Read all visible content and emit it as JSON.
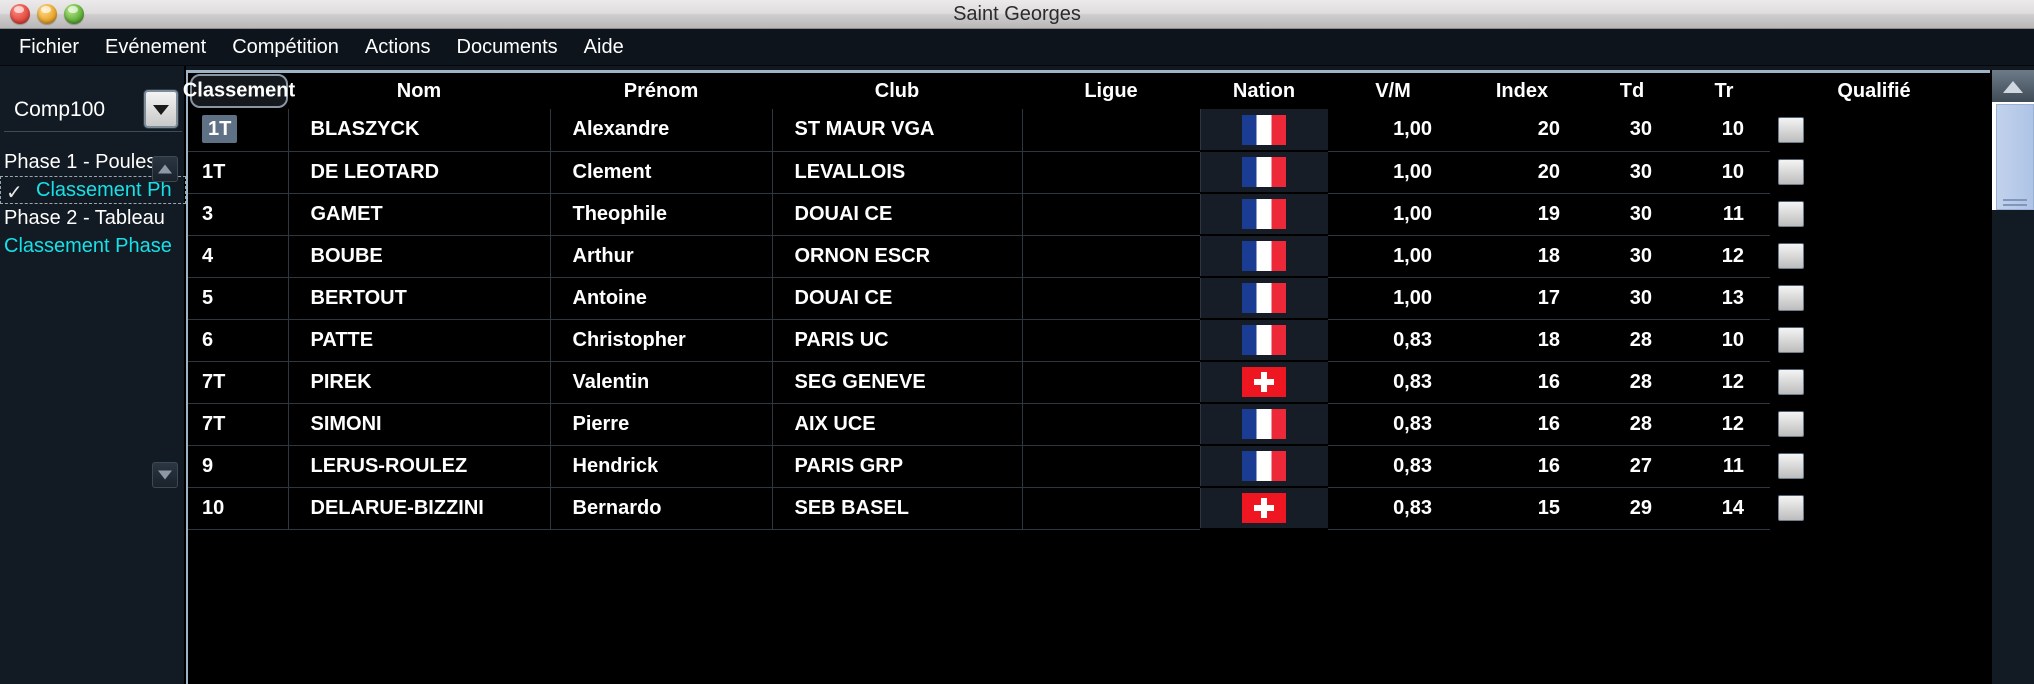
{
  "window": {
    "title": "Saint Georges",
    "buttons": {
      "close": "close-button",
      "minimize": "minimize-button",
      "maximize": "maximize-button"
    }
  },
  "menubar": {
    "items": [
      "Fichier",
      "Evénement",
      "Compétition",
      "Actions",
      "Documents",
      "Aide"
    ]
  },
  "sidebar": {
    "competition_selector": {
      "value": "Comp100"
    },
    "tree": [
      {
        "label": "Phase 1 - Poules",
        "type": "phase",
        "selected": false,
        "checked": false
      },
      {
        "label": "Classement Ph",
        "type": "sub",
        "selected": true,
        "checked": true
      },
      {
        "label": "Phase 2 - Tableau",
        "type": "phase",
        "selected": false,
        "checked": false
      },
      {
        "label": "Classement Phase",
        "type": "sub-top",
        "selected": false,
        "checked": false
      }
    ],
    "scroll_up": "▲",
    "scroll_down": "▼"
  },
  "table": {
    "columns": [
      "Classement",
      "Nom",
      "Prénom",
      "Club",
      "Ligue",
      "Nation",
      "V/M",
      "Index",
      "Td",
      "Tr",
      "Qualifié"
    ],
    "rows": [
      {
        "classement": "1T",
        "nom": "BLASZYCK",
        "prenom": "Alexandre",
        "club": "ST MAUR VGA",
        "ligue": "",
        "nation": "fr",
        "vm": "1,00",
        "index": "20",
        "td": "30",
        "tr": "10",
        "qualifie": false,
        "selected": true
      },
      {
        "classement": "1T",
        "nom": "DE LEOTARD",
        "prenom": "Clement",
        "club": "LEVALLOIS",
        "ligue": "",
        "nation": "fr",
        "vm": "1,00",
        "index": "20",
        "td": "30",
        "tr": "10",
        "qualifie": false,
        "selected": false
      },
      {
        "classement": "3",
        "nom": "GAMET",
        "prenom": "Theophile",
        "club": "DOUAI CE",
        "ligue": "",
        "nation": "fr",
        "vm": "1,00",
        "index": "19",
        "td": "30",
        "tr": "11",
        "qualifie": false,
        "selected": false
      },
      {
        "classement": "4",
        "nom": "BOUBE",
        "prenom": "Arthur",
        "club": "ORNON ESCR",
        "ligue": "",
        "nation": "fr",
        "vm": "1,00",
        "index": "18",
        "td": "30",
        "tr": "12",
        "qualifie": false,
        "selected": false
      },
      {
        "classement": "5",
        "nom": "BERTOUT",
        "prenom": "Antoine",
        "club": "DOUAI CE",
        "ligue": "",
        "nation": "fr",
        "vm": "1,00",
        "index": "17",
        "td": "30",
        "tr": "13",
        "qualifie": false,
        "selected": false
      },
      {
        "classement": "6",
        "nom": "PATTE",
        "prenom": "Christopher",
        "club": "PARIS UC",
        "ligue": "",
        "nation": "fr",
        "vm": "0,83",
        "index": "18",
        "td": "28",
        "tr": "10",
        "qualifie": false,
        "selected": false
      },
      {
        "classement": "7T",
        "nom": "PIREK",
        "prenom": "Valentin",
        "club": "SEG GENEVE",
        "ligue": "",
        "nation": "ch",
        "vm": "0,83",
        "index": "16",
        "td": "28",
        "tr": "12",
        "qualifie": false,
        "selected": false
      },
      {
        "classement": "7T",
        "nom": "SIMONI",
        "prenom": "Pierre",
        "club": "AIX UCE",
        "ligue": "",
        "nation": "fr",
        "vm": "0,83",
        "index": "16",
        "td": "28",
        "tr": "12",
        "qualifie": false,
        "selected": false
      },
      {
        "classement": "9",
        "nom": "LERUS-ROULEZ",
        "prenom": "Hendrick",
        "club": "PARIS GRP",
        "ligue": "",
        "nation": "fr",
        "vm": "0,83",
        "index": "16",
        "td": "27",
        "tr": "11",
        "qualifie": false,
        "selected": false
      },
      {
        "classement": "10",
        "nom": "DELARUE-BIZZINI",
        "prenom": "Bernardo",
        "club": "SEB BASEL",
        "ligue": "",
        "nation": "ch",
        "vm": "0,83",
        "index": "15",
        "td": "29",
        "tr": "14",
        "qualifie": false,
        "selected": false
      }
    ]
  },
  "scrollbar": {
    "up_arrow": "▲"
  },
  "colors": {
    "accent_cyan": "#16e0e8",
    "selection": "#5f7185",
    "flag_france_blue": "#1b3c93",
    "flag_france_red": "#ed2939",
    "flag_swiss_red": "#ee1620",
    "table_bg": "#000000",
    "chrome_bg": "#121a23"
  }
}
